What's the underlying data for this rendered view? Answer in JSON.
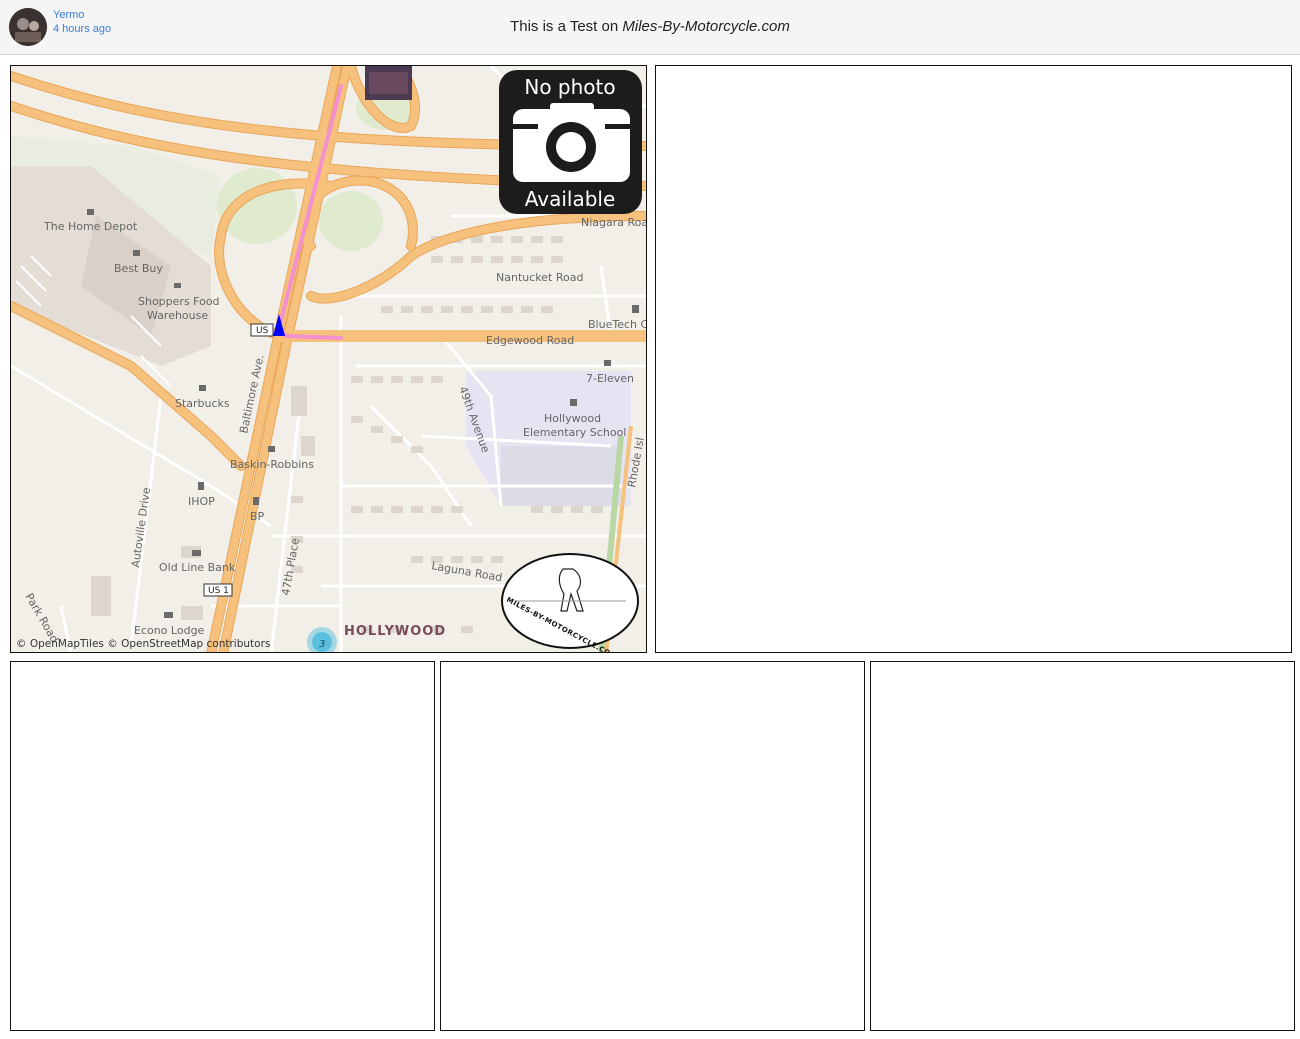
{
  "header": {
    "user_name": "Yermo",
    "post_time": "4 hours ago",
    "title_prefix": "This is a Test on ",
    "title_site": "Miles-By-Motorcycle.com"
  },
  "map": {
    "attribution": "© OpenMapTiles © OpenStreetMap contributors",
    "no_photo_line1": "No photo",
    "no_photo_line2": "Available",
    "cluster_count": "3",
    "logo_text": "MILES-BY-MOTORCYCLE.COM",
    "labels": {
      "home_depot": "The Home Depot",
      "best_buy": "Best Buy",
      "shoppers_1": "Shoppers Food",
      "shoppers_2": "Warehouse",
      "starbucks": "Starbucks",
      "baskin": "Baskin-Robbins",
      "ihop": "IHOP",
      "bp": "BP",
      "old_line_bank": "Old Line Bank",
      "econo_lodge": "Econo Lodge",
      "hollywood": "HOLLYWOOD",
      "niagara": "Niagara Roa",
      "nantucket": "Nantucket Road",
      "bluetech": "BlueTech C",
      "edgewood": "Edgewood Road",
      "seven_eleven": "7-Eleven",
      "school_1": "Hollywood",
      "school_2": "Elementary School",
      "avenue_49": "49th Avenue",
      "laguna": "Laguna Road",
      "place_47": "47th Place",
      "baltimore": "Baltimore Ave.",
      "autoville": "Autoville Drive",
      "park_road": "Park Road",
      "rhode": "Rhode Isl",
      "us1_a": "US",
      "us1_b": "US 1"
    }
  },
  "colors": {
    "map_bg": "#f2efe9",
    "highway": "#f6c17c",
    "highway_edge": "#e9a659",
    "route": "#f48fd0",
    "marker": "#0000ff",
    "park": "#dfeacf",
    "school": "#e6e3f2",
    "cluster": "#5bc0de",
    "link": "#3b7fd6"
  }
}
